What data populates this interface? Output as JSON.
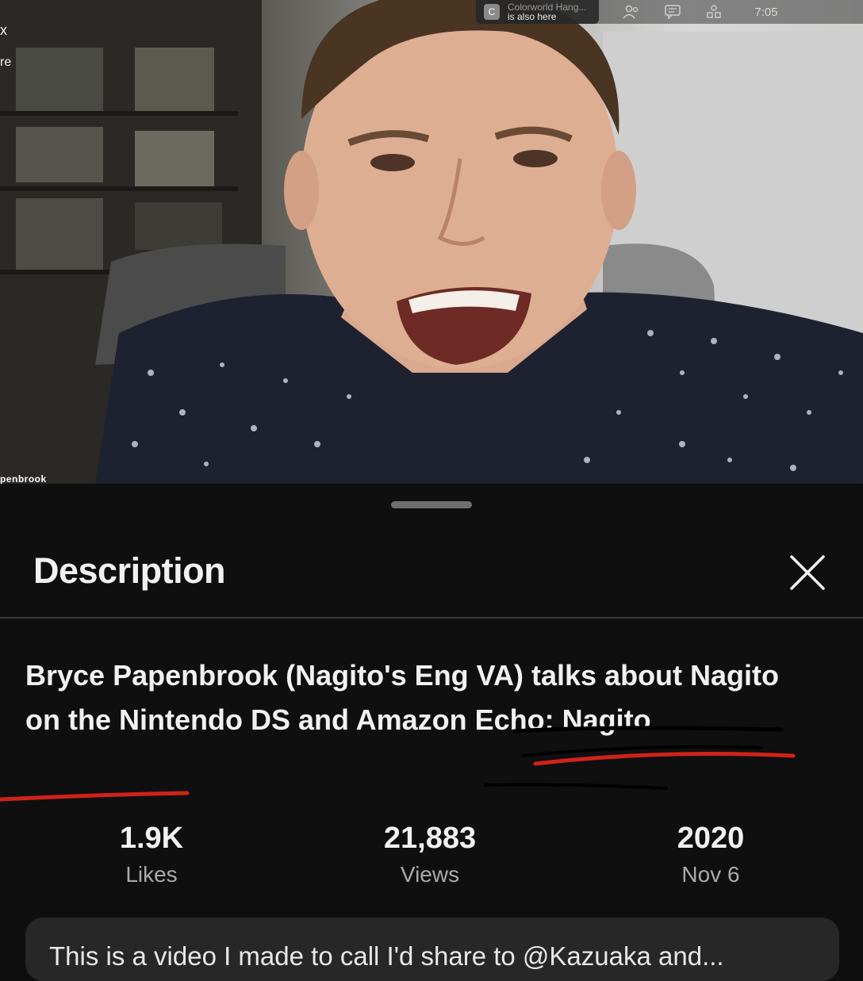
{
  "video": {
    "zoom_notice_line1": "Colorworld Hang...",
    "zoom_notice_line2": "is also here",
    "zoom_avatar_initial": "C",
    "zoom_time": "7:05",
    "left_text_a": "x",
    "left_text_b": "re",
    "name_tag": "penbrook"
  },
  "description": {
    "title": "Description",
    "video_title": "Bryce Papenbrook (Nagito's Eng VA) talks about Nagito on the Nintendo DS and Amazon Echo: Nagito",
    "stats": [
      {
        "value": "1.9K",
        "label": "Likes"
      },
      {
        "value": "21,883",
        "label": "Views"
      },
      {
        "value": "2020",
        "label": "Nov 6"
      }
    ],
    "body_text": "This is a video I made to call I'd share to @Kazuaka and..."
  },
  "colors": {
    "background": "#0f0f0f",
    "text_primary": "#f1f1f1",
    "text_secondary": "#aaaaaa",
    "card": "#272727",
    "annotation_red": "#d0231a",
    "annotation_black": "#000000"
  },
  "icons": [
    "close-icon",
    "participants-icon",
    "chat-icon",
    "apps-icon"
  ]
}
